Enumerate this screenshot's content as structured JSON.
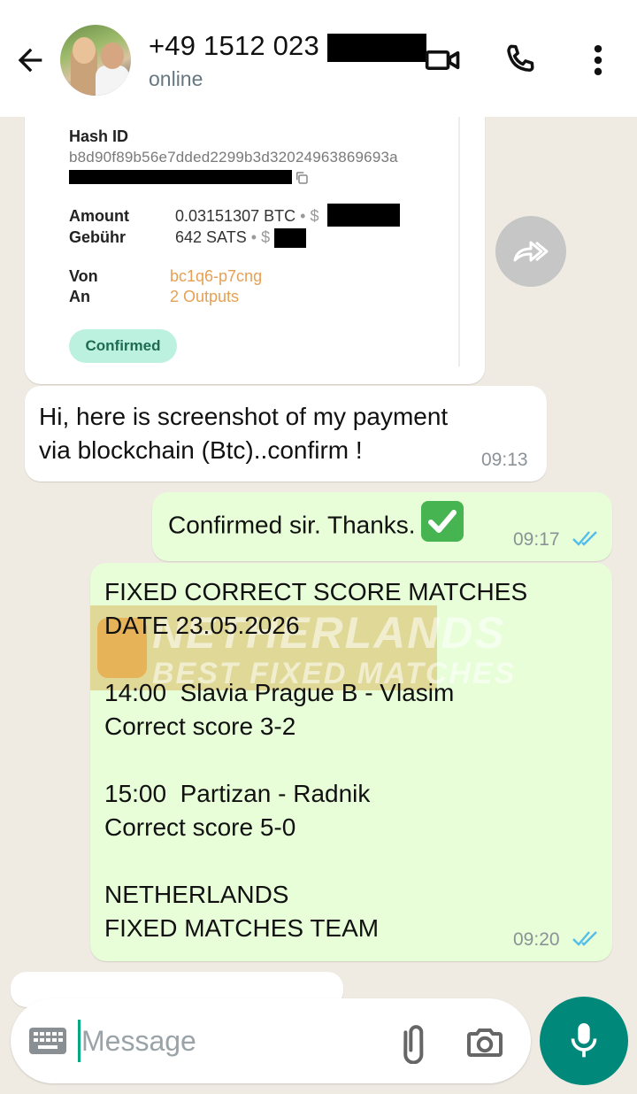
{
  "header": {
    "contact_name": "+49 1512 023",
    "status": "online"
  },
  "receipt": {
    "hash_label": "Hash ID",
    "hash_value": "b8d90f89b56e7dded2299b3d32024963869693a",
    "amount_label": "Amount",
    "amount_value": "0.03151307 BTC",
    "amount_sep": "•",
    "amount_currency": "$",
    "fee_label": "Gebühr",
    "fee_value": "642 SATS",
    "fee_sep": "•",
    "fee_currency": "$",
    "from_label": "Von",
    "from_value": "bc1q6-p7cng",
    "to_label": "An",
    "to_value": "2 Outputs",
    "status_label": "Confirmed"
  },
  "messages": [
    {
      "text": "Hi, here is screenshot of my payment\nvia blockchain (Btc)..confirm !",
      "time": "09:13"
    },
    {
      "text": "Confirmed sir. Thanks.",
      "time": "09:17"
    },
    {
      "text": "FIXED CORRECT SCORE MATCHES\nDATE 23.05.2026\n\n14:00  Slavia Prague B - Vlasim\nCorrect score 3-2\n\n15:00  Partizan - Radnik\nCorrect score 5-0\n\nNETHERLANDS\nFIXED MATCHES TEAM",
      "time": "09:20"
    }
  ],
  "watermark": {
    "line1": "NETHERLANDS",
    "line2": "BEST FIXED MATCHES"
  },
  "composer": {
    "placeholder": "Message"
  },
  "colors": {
    "accent": "#00897b",
    "outgoing_bubble": "#e7fed8",
    "read_ticks": "#53bdeb"
  },
  "icons": [
    "back-arrow-icon",
    "video-call-icon",
    "phone-icon",
    "more-vert-icon",
    "forward-icon",
    "copy-icon",
    "keyboard-icon",
    "attach-icon",
    "camera-icon",
    "mic-icon"
  ]
}
